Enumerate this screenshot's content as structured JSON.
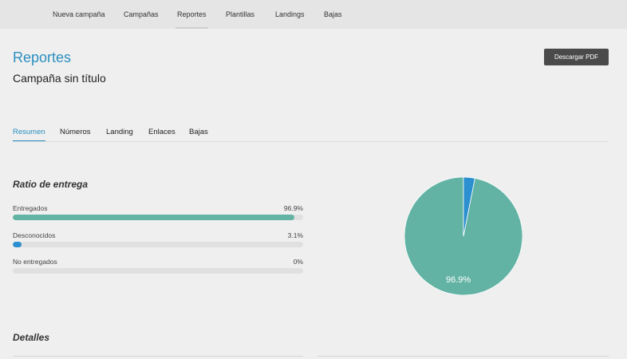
{
  "topnav": {
    "items": [
      {
        "label": "Nueva campaña"
      },
      {
        "label": "Campañas"
      },
      {
        "label": "Reportes"
      },
      {
        "label": "Plantillas"
      },
      {
        "label": "Landings"
      },
      {
        "label": "Bajas"
      }
    ],
    "active": "Reportes"
  },
  "header": {
    "title": "Reportes",
    "subtitle": "Campaña sin título",
    "pdf_button": "Descargar PDF"
  },
  "tabs": {
    "items": [
      {
        "label": "Resumen"
      },
      {
        "label": "Números"
      },
      {
        "label": "Landing"
      },
      {
        "label": "Enlaces"
      },
      {
        "label": "Bajas"
      }
    ],
    "active": "Resumen"
  },
  "delivery": {
    "title": "Ratio de entrega",
    "metrics": [
      {
        "label": "Entregados",
        "value_text": "96.9%",
        "value": 96.9,
        "color": "#62b3a4"
      },
      {
        "label": "Desconocidos",
        "value_text": "3.1%",
        "value": 3.1,
        "color": "#2b8fd0"
      },
      {
        "label": "No entregados",
        "value_text": "0%",
        "value": 0,
        "color": "#62b3a4"
      }
    ]
  },
  "chart_data": {
    "type": "pie",
    "slices": [
      {
        "label": "Entregados",
        "value": 96.9,
        "color": "#62b3a4"
      },
      {
        "label": "Desconocidos",
        "value": 3.1,
        "color": "#2b8fd0"
      }
    ],
    "data_labels": [
      "96.9%"
    ]
  },
  "details": {
    "title": "Detalles"
  }
}
